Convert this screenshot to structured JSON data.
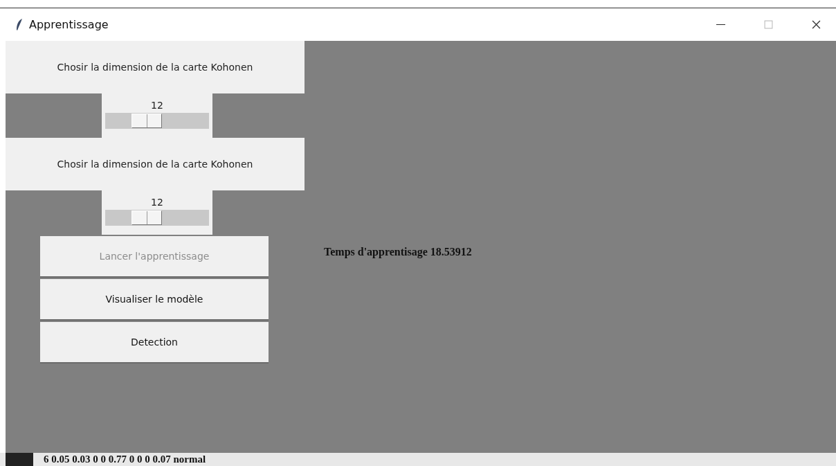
{
  "window": {
    "title": "Apprentissage"
  },
  "sliders": [
    {
      "label": "Chosir la dimension de la carte Kohonen",
      "reading": "12",
      "level": 0.36
    },
    {
      "label": "Chosir la dimension de la carte Kohonen",
      "reading": "12",
      "level": 0.36
    }
  ],
  "buttons": [
    {
      "label": "Lancer l'apprentissage",
      "disabled": true
    },
    {
      "label": "Visualiser le modèle",
      "disabled": false
    },
    {
      "label": "Detection",
      "disabled": false
    }
  ],
  "result": "Temps d'apprentisage 18.53912",
  "background_text": "6 0.05 0.03 0 0 0.77 0 0 0 0.07 normal"
}
